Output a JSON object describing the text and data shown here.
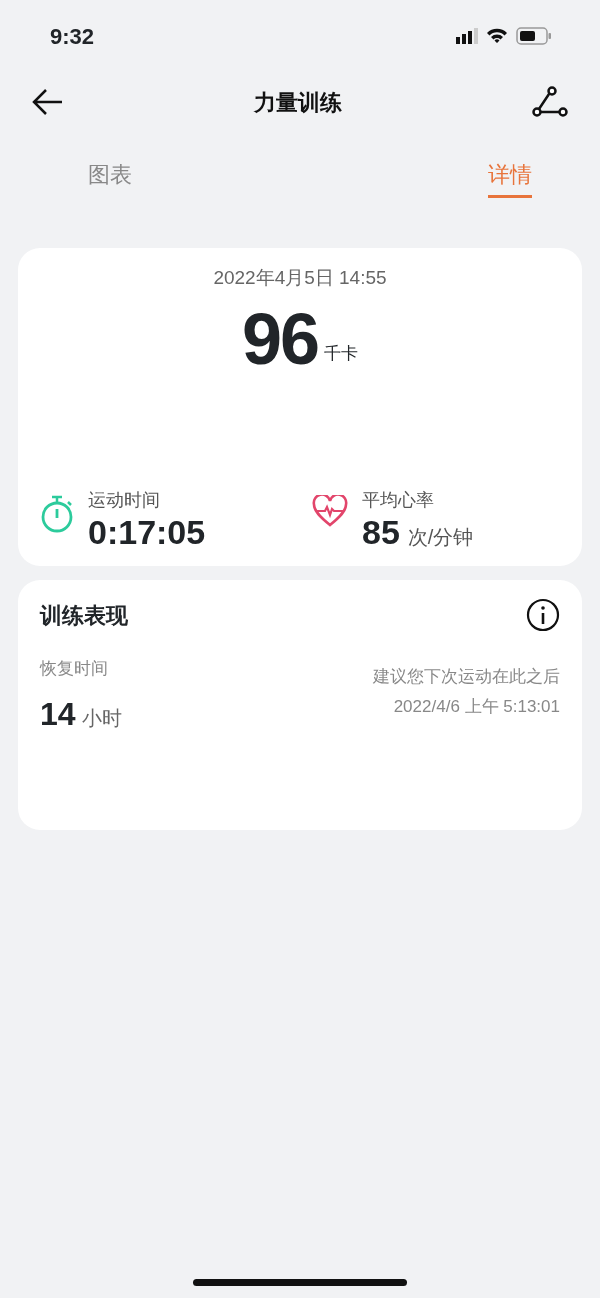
{
  "status_bar": {
    "time": "9:32"
  },
  "header": {
    "title": "力量训练"
  },
  "tabs": [
    {
      "label": "图表",
      "selected": false
    },
    {
      "label": "详情",
      "selected": true
    }
  ],
  "summary": {
    "datetime": "2022年4月5日 14:55",
    "calories": "96",
    "calories_unit": "千卡",
    "stats": [
      {
        "kind": "duration",
        "label": "运动时间",
        "value": "0:17:05"
      },
      {
        "kind": "heart",
        "label": "平均心率",
        "value": "85",
        "unit": "次/分钟"
      }
    ]
  },
  "performance": {
    "title": "训练表现",
    "recovery_label": "恢复时间",
    "recovery_value": "14",
    "recovery_unit": "小时",
    "advice": "建议您下次运动在此之后",
    "advice_time": "2022/4/6 上午 5:13:01"
  }
}
